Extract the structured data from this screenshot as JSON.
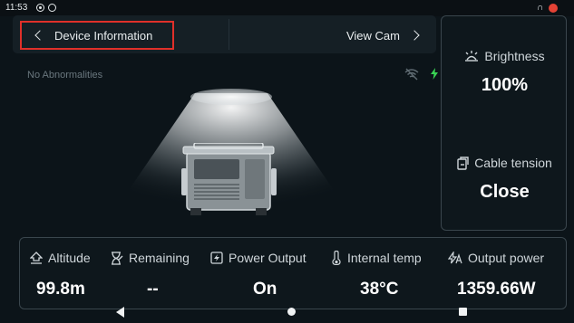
{
  "status_bar": {
    "time": "11:53",
    "headset_icon": "headset-icon"
  },
  "header": {
    "back_label": "Device Information",
    "view_cam_label": "View Cam"
  },
  "status_message": "No Abnormalities",
  "right_panel": {
    "brightness": {
      "label": "Brightness",
      "value": "100%"
    },
    "cable_tension": {
      "label": "Cable tension",
      "value": "Close"
    }
  },
  "stats": [
    {
      "label": "Altitude",
      "value": "99.8m",
      "icon": "altitude-icon"
    },
    {
      "label": "Remaining",
      "value": "--",
      "icon": "hourglass-icon"
    },
    {
      "label": "Power Output",
      "value": "On",
      "icon": "power-output-icon"
    },
    {
      "label": "Internal temp",
      "value": "38°C",
      "icon": "thermometer-icon"
    },
    {
      "label": "Output power",
      "value": "1359.66W",
      "icon": "power-flow-icon"
    }
  ],
  "colors": {
    "background": "#0c1419",
    "highlight_border": "#e0302a",
    "charge_green": "#39d353",
    "battery_red": "#e44235"
  }
}
